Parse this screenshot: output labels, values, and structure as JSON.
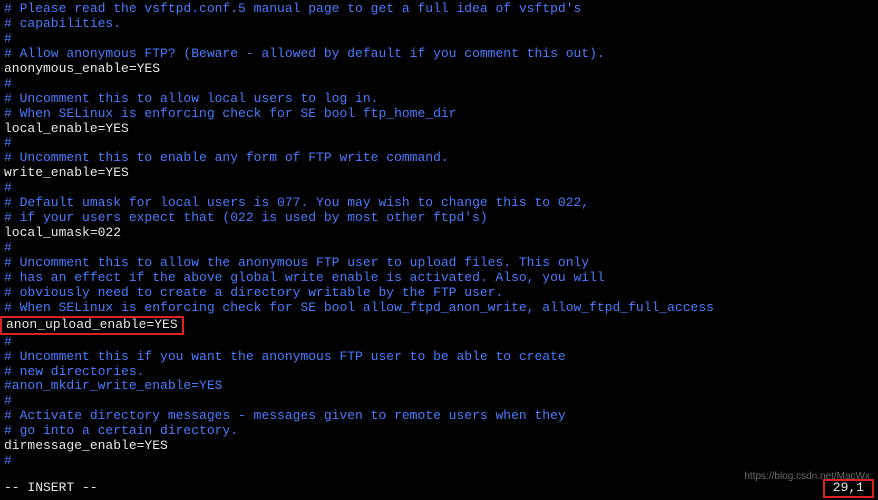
{
  "lines": [
    {
      "cls": "comment",
      "text": "# Please read the vsftpd.conf.5 manual page to get a full idea of vsftpd's"
    },
    {
      "cls": "comment",
      "text": "# capabilities."
    },
    {
      "cls": "comment",
      "text": "#"
    },
    {
      "cls": "comment",
      "text": "# Allow anonymous FTP? (Beware - allowed by default if you comment this out)."
    },
    {
      "cls": "setting",
      "text": "anonymous_enable=YES"
    },
    {
      "cls": "comment",
      "text": "#"
    },
    {
      "cls": "comment",
      "text": "# Uncomment this to allow local users to log in."
    },
    {
      "cls": "comment",
      "text": "# When SELinux is enforcing check for SE bool ftp_home_dir"
    },
    {
      "cls": "setting",
      "text": "local_enable=YES"
    },
    {
      "cls": "comment",
      "text": "#"
    },
    {
      "cls": "comment",
      "text": "# Uncomment this to enable any form of FTP write command."
    },
    {
      "cls": "setting",
      "text": "write_enable=YES"
    },
    {
      "cls": "comment",
      "text": "#"
    },
    {
      "cls": "comment",
      "text": "# Default umask for local users is 077. You may wish to change this to 022,"
    },
    {
      "cls": "comment",
      "text": "# if your users expect that (022 is used by most other ftpd's)"
    },
    {
      "cls": "setting",
      "text": "local_umask=022"
    },
    {
      "cls": "comment",
      "text": "#"
    },
    {
      "cls": "comment",
      "text": "# Uncomment this to allow the anonymous FTP user to upload files. This only"
    },
    {
      "cls": "comment",
      "text": "# has an effect if the above global write enable is activated. Also, you will"
    },
    {
      "cls": "comment",
      "text": "# obviously need to create a directory writable by the FTP user."
    },
    {
      "cls": "comment",
      "text": "# When SELinux is enforcing check for SE bool allow_ftpd_anon_write, allow_ftpd_full_access"
    },
    {
      "cls": "setting",
      "text": "anon_upload_enable=YES",
      "boxed": true
    },
    {
      "cls": "comment",
      "text": "#"
    },
    {
      "cls": "comment",
      "text": "# Uncomment this if you want the anonymous FTP user to be able to create"
    },
    {
      "cls": "comment",
      "text": "# new directories."
    },
    {
      "cls": "comment",
      "text": "#anon_mkdir_write_enable=YES"
    },
    {
      "cls": "comment",
      "text": "#"
    },
    {
      "cls": "comment",
      "text": "# Activate directory messages - messages given to remote users when they"
    },
    {
      "cls": "comment",
      "text": "# go into a certain directory."
    },
    {
      "cls": "setting",
      "text": "dirmessage_enable=YES"
    },
    {
      "cls": "comment",
      "text": "#"
    }
  ],
  "status": {
    "mode": "-- INSERT --",
    "position": "29,1"
  },
  "watermark": "https://blog.csdn.net/MacWx"
}
